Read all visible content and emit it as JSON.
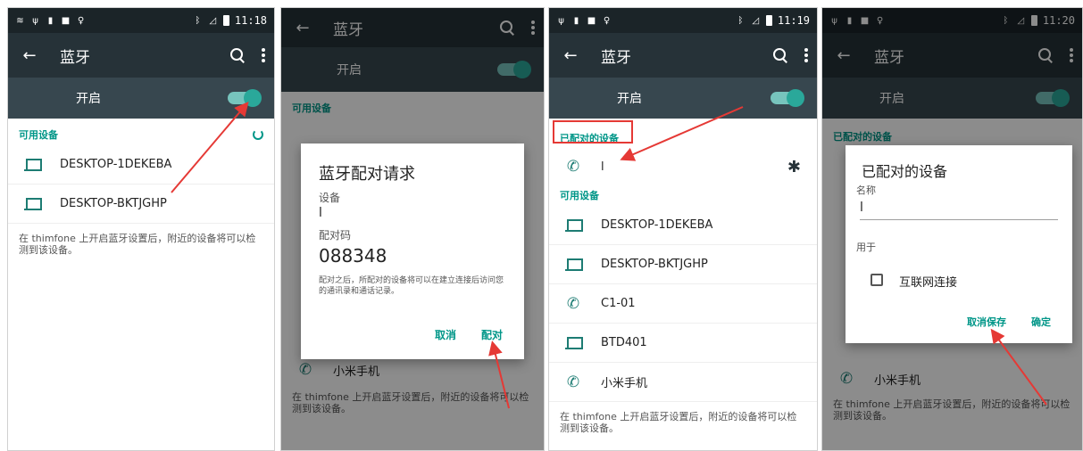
{
  "accent_color": "#009688",
  "arrow_color": "#e53935",
  "panel1": {
    "time": "11:18",
    "title": "蓝牙",
    "switch_label": "开启",
    "section": "可用设备",
    "devices": [
      {
        "name": "DESKTOP-1DEKEBA",
        "icon": "laptop-icon"
      },
      {
        "name": "DESKTOP-BKTJGHP",
        "icon": "laptop-icon"
      }
    ],
    "hint": "在 thimfone 上开启蓝牙设置后，附近的设备将可以检测到该设备。"
  },
  "panel2": {
    "title": "蓝牙",
    "switch_label": "开启",
    "section": "可用设备",
    "bottom_device": "小米手机",
    "hint": "在 thimfone 上开启蓝牙设置后，附近的设备将可以检测到该设备。",
    "dialog": {
      "title": "蓝牙配对请求",
      "device_label": "设备",
      "device_value": "l",
      "code_label": "配对码",
      "code_value": "088348",
      "note": "配对之后，所配对的设备将可以在建立连接后访问您的通讯录和通话记录。",
      "cancel": "取消",
      "pair": "配对"
    }
  },
  "panel3": {
    "time": "11:19",
    "title": "蓝牙",
    "switch_label": "开启",
    "paired_section": "已配对的设备",
    "paired_device": "l",
    "section": "可用设备",
    "devices": [
      {
        "name": "DESKTOP-1DEKEBA",
        "icon": "laptop-icon"
      },
      {
        "name": "DESKTOP-BKTJGHP",
        "icon": "laptop-icon"
      },
      {
        "name": "C1-01",
        "icon": "phone-icon"
      },
      {
        "name": "BTD401",
        "icon": "laptop-icon"
      },
      {
        "name": "小米手机",
        "icon": "phone-icon"
      }
    ],
    "hint": "在 thimfone 上开启蓝牙设置后，附近的设备将可以检测到该设备。"
  },
  "panel4": {
    "time": "11:20",
    "title": "蓝牙",
    "switch_label": "开启",
    "paired_section": "已配对的设备",
    "bottom_device": "小米手机",
    "hint": "在 thimfone 上开启蓝牙设置后，附近的设备将可以检测到该设备。",
    "dialog": {
      "title": "已配对的设备",
      "name_label": "名称",
      "name_value": "l",
      "use_label": "用于",
      "checkbox_label": "互联网连接",
      "cancel_save": "取消保存",
      "confirm": "确定"
    }
  }
}
